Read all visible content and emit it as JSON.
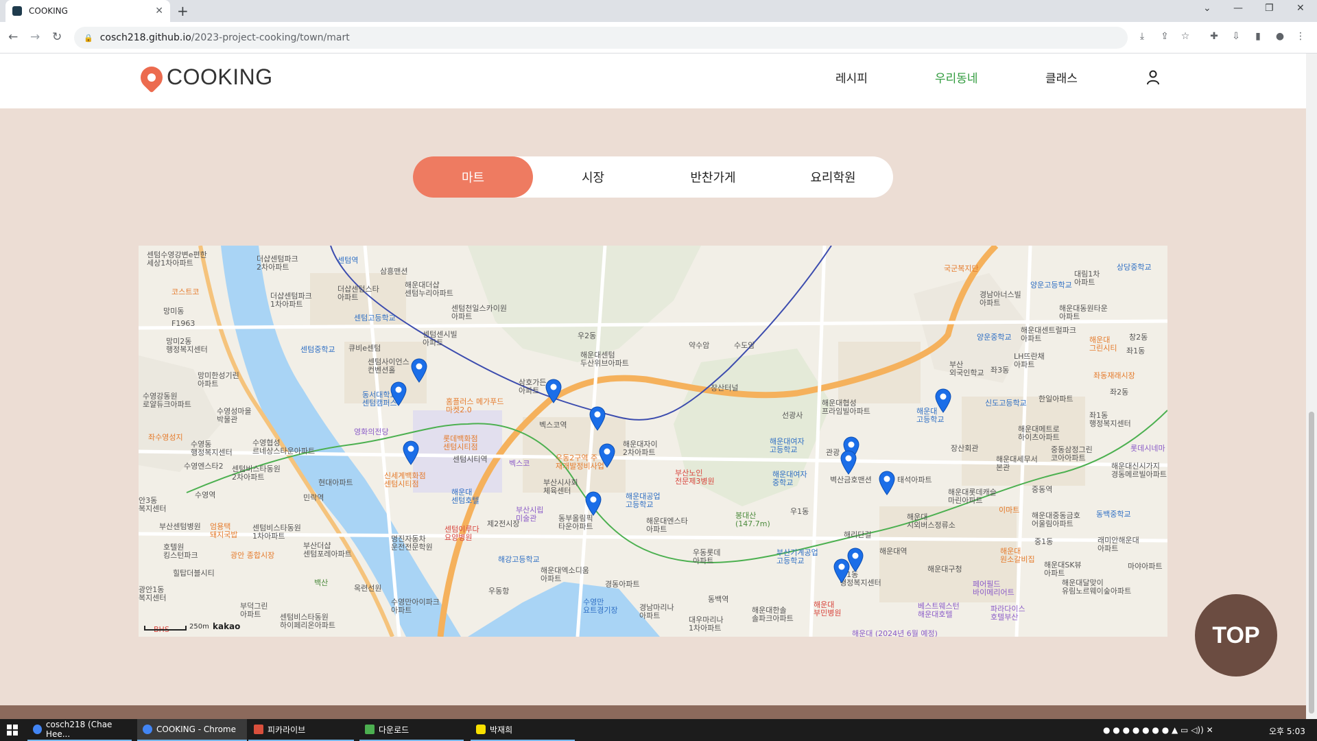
{
  "browser": {
    "tab_title": "COOKING",
    "url_host": "cosch218.github.io",
    "url_path": "/2023-project-cooking/town/mart"
  },
  "header": {
    "logo_text": "COOKING",
    "nav": [
      "레시피",
      "우리동네",
      "클래스"
    ],
    "active_nav": "우리동네"
  },
  "categories": {
    "items": [
      "마트",
      "시장",
      "반찬가게",
      "요리학원"
    ],
    "active": "마트"
  },
  "map": {
    "provider": "kakao",
    "scale": "250m",
    "labels": {
      "l1": "센텀수영강변e편한\n세상1차아파트",
      "l2": "더샵센텀파크\n2차아파트",
      "l3": "센텀역",
      "l4": "삼흥맨션",
      "l5": "코스트코",
      "l6": "더샵센텀스타\n아파트",
      "l7": "해운대더샵\n센텀누리아파트",
      "l8": "망미동",
      "l9": "F1963",
      "l10": "더샵센텀파크\n1차아파트",
      "l11": "센텀고등학교",
      "l12": "센텀천일스카이원\n아파트",
      "l13": "망미2동\n행정복지센터",
      "l14": "큐비e센텀",
      "l15": "센텀센시빌\n아파트",
      "l16": "우2동",
      "l17": "약수암",
      "l18": "수도암",
      "l19": "센텀중학교",
      "l20": "센텀사이언스\n컨벤션홀",
      "l21": "해운대센텀\n두산위브아파트",
      "l22": "망미한성기린\n아파트",
      "l23": "동서대학교\n센텀캠퍼스",
      "l24": "삼호가든\n아파트",
      "l25": "홈플러스 메가푸드\n마켓2.0",
      "l26": "수영강동원\n로얄듀크아파트",
      "l27": "수영성마을\n박물관",
      "l28": "영화의전당",
      "l29": "벡스코역",
      "l30": "벡스코",
      "l31": "좌수영성지",
      "l32": "수영동\n행정복지센터",
      "l33": "수영협성\n르네상스타운아파트",
      "l34": "롯데백화점\n센텀시티점",
      "l35": "센텀시티역",
      "l36": "해운대자이\n2차아파트",
      "l37": "수영엔스타2",
      "l38": "센텀비스타동원\n2차아파트",
      "l39": "신세계백화점\n센텀시티점",
      "l40": "우동2구역 주\n재개발정비사업",
      "l41": "부산노인\n전문제3병원",
      "l42": "현대아파트",
      "l43": "해운대\n센텀호텔",
      "l44": "해운대공업\n고등학교",
      "l45": "수영역",
      "l46": "민락역",
      "l47": "부산시립\n미술관",
      "l48": "동부올림픽\n타운아파트",
      "l49": "해운대엔스타\n아파트",
      "l50": "부산센텀병원",
      "l51": "엄용택\n돼지국밥",
      "l52": "센텀비스타동원\n1차아파트",
      "l53": "센텀이루다\n요양병원",
      "l54": "명진자동차\n운전전문학원",
      "l55": "해강고등학교",
      "l56": "우동롯데\n아파트",
      "l57": "광안 종합시장",
      "l58": "부산더샵\n센텀포레아파트",
      "l59": "호텔원\n킹스턴파크",
      "l60": "해운대엑소디움\n아파트",
      "l61": "경동아파트",
      "l62": "힐탑더블시티",
      "l63": "백산",
      "l64": "옥련선원",
      "l65": "수영만아이파크\n아파트",
      "l66": "우동항",
      "l67": "수영만\n요트경기장",
      "l68": "경남마리나\n아파트",
      "l69": "대우마리나\n1차아파트",
      "l70": "동백역",
      "l71": "부덕그린\n아파트",
      "l72": "센텀비스타동원\n하이페리온아파트",
      "l73": "장산터널",
      "l74": "선광사",
      "l75": "해운대협성\n프라임빌아파트",
      "l76": "해운대여자\n고등학교",
      "l77": "해운대여자\n중학교",
      "l78": "봉대산\n(147.7m)",
      "l79": "우1동",
      "l80": "벽산금호맨션",
      "l81": "태석아파트",
      "l82": "해리단길",
      "l83": "해운대역",
      "l84": "부산기계공업\n고등학교",
      "l85": "우1동\n행정복지센터",
      "l86": "해운대\n부민병원",
      "l87": "해운대한솔\n솔파크아파트",
      "l88": "국군복지단",
      "l89": "경남아너스빌\n아파트",
      "l90": "양운고등학교",
      "l91": "대림1차\n아파트",
      "l92": "상당중학교",
      "l93": "해운대동원타운\n아파트",
      "l94": "양운중학교",
      "l95": "해운대센트럴파크\n아파트",
      "l96": "부산\n외국인학교",
      "l97": "좌3동",
      "l98": "LH뜨란채\n아파트",
      "l99": "해운대\n그린시티",
      "l100": "좌1동",
      "l101": "좌동재래시장",
      "l102": "신도고등학교",
      "l103": "한일아파트",
      "l104": "해운대\n고등학교",
      "l105": "장산회관",
      "l106": "해운대메트로\n하이츠아파트",
      "l107": "좌1동\n행정복지센터",
      "l108": "중동삼정그린\n코아아파트",
      "l109": "해운대세무서\n본관",
      "l110": "중동역",
      "l111": "해운대롯데캐슬\n마린아파트",
      "l112": "이마트",
      "l113": "해운대중동금호\n어울림아파트",
      "l114": "동백중학교",
      "l115": "해운대\n시외버스정류소",
      "l116": "중1동",
      "l117": "래미안해운대\n아파트",
      "l118": "해운대구청",
      "l119": "해운대\n원소갈비집",
      "l120": "해운대SK뷰\n아파트",
      "l121": "마야아파트",
      "l122": "페어필드\n바이메리어트",
      "l123": "해운대달맞이\n유림노르웨이숲아파트",
      "l124": "베스트웨스턴\n해운대호텔",
      "l125": "파라다이스\n호텔부산",
      "l126": "해운대 (2024년 6월 예정)",
      "l127": "관광",
      "l128": "롯데시네마",
      "l129": "해운대신시가지\n경동메르빌아파트",
      "l130": "좌2동",
      "l131": "창2동",
      "l132": "제2전시장",
      "l133": "부산시사회\n체육센터",
      "l134": "안3동\n복지센터",
      "l135": "광안1동\n복지센터",
      "l136": "BHS"
    }
  },
  "top_button": "TOP",
  "taskbar": {
    "items": [
      "cosch218 (Chae Hee...",
      "COOKING - Chrome",
      "피카라이브",
      "다운로드",
      "박재희"
    ],
    "clock": "오후 5:03"
  },
  "colors": {
    "accent": "#ee7b61",
    "nav_active": "#2f9a3c",
    "page_bg": "#ecddd4",
    "top_btn": "#6b4c41"
  }
}
